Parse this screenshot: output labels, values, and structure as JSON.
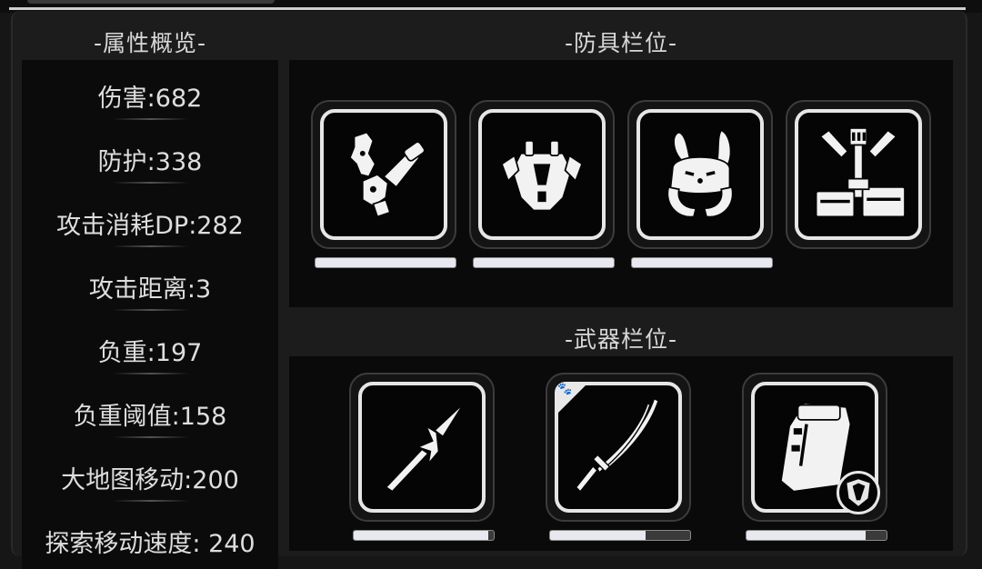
{
  "sections": {
    "stats_title": "-属性概览-",
    "armor_title": "-防具栏位-",
    "weapon_title": "-武器栏位-"
  },
  "stats": [
    {
      "label": "伤害:682"
    },
    {
      "label": "防护:338"
    },
    {
      "label": "攻击消耗DP:282"
    },
    {
      "label": "攻击距离:3"
    },
    {
      "label": "负重:197"
    },
    {
      "label": "负重阈值:158"
    },
    {
      "label": "大地图移动:200"
    },
    {
      "label": "探索移动速度: 240"
    }
  ],
  "armor_slots": [
    {
      "icon": "gauntlet-armor-icon",
      "durability": 1.0
    },
    {
      "icon": "chest-armor-icon",
      "durability": 1.0
    },
    {
      "icon": "bunny-helmet-icon",
      "durability": 1.0
    },
    {
      "icon": "backpack-frame-icon",
      "durability": null
    }
  ],
  "weapon_slots": [
    {
      "icon": "spear-icon",
      "durability": 0.98
    },
    {
      "icon": "katana-icon",
      "durability": 0.7,
      "badge": "paw-badge-icon"
    },
    {
      "icon": "shield-case-icon",
      "durability": 0.85,
      "badge": "shield-badge-icon"
    }
  ],
  "colors": {
    "background": "#161616",
    "panel": "#0a0a0a",
    "slot_border": "#e6e6e6",
    "bar_fill": "#e8e8f0",
    "text": "#dcdcdc"
  }
}
